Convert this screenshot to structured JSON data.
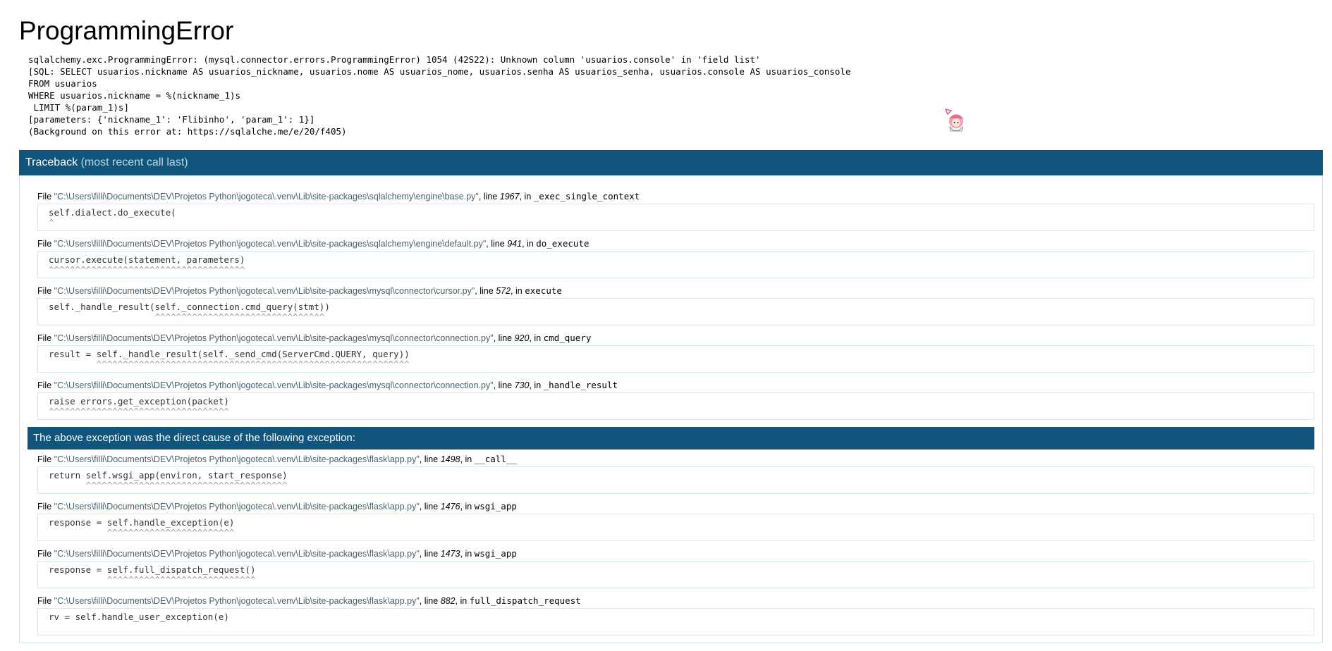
{
  "title": "ProgrammingError",
  "error_message": "sqlalchemy.exc.ProgrammingError: (mysql.connector.errors.ProgrammingError) 1054 (42S22): Unknown column 'usuarios.console' in 'field list'\n[SQL: SELECT usuarios.nickname AS usuarios_nickname, usuarios.nome AS usuarios_nome, usuarios.senha AS usuarios_senha, usuarios.console AS usuarios_console\nFROM usuarios\nWHERE usuarios.nickname = %(nickname_1)s\n LIMIT %(param_1)s]\n[parameters: {'nickname_1': 'Flibinho', 'param_1': 1}]\n(Background on this error at: https://sqlalche.me/e/20/f405)",
  "traceback": {
    "label": "Traceback",
    "note": "(most recent call last)",
    "file_word": "File",
    "line_word": "line",
    "in_word": "in",
    "frames_before": [
      {
        "file": "\"C:\\Users\\filli\\Documents\\DEV\\Projetos Python\\jogoteca\\.venv\\Lib\\site-packages\\sqlalchemy\\engine\\base.py\"",
        "line": "1967",
        "func": "_exec_single_context",
        "code": "self.dialect.do_execute(",
        "caret": "^"
      },
      {
        "file": "\"C:\\Users\\filli\\Documents\\DEV\\Projetos Python\\jogoteca\\.venv\\Lib\\site-packages\\sqlalchemy\\engine\\default.py\"",
        "line": "941",
        "func": "do_execute",
        "code": "cursor.execute(statement, parameters)",
        "caret": "^^^^^^^^^^^^^^^^^^^^^^^^^^^^^^^^^^^^^"
      },
      {
        "file": "\"C:\\Users\\filli\\Documents\\DEV\\Projetos Python\\jogoteca\\.venv\\Lib\\site-packages\\mysql\\connector\\cursor.py\"",
        "line": "572",
        "func": "execute",
        "code": "self._handle_result(self._connection.cmd_query(stmt))",
        "caret": "                    ^^^^^^^^^^^^^^^^^^^^^^^^^^^^^^^^"
      },
      {
        "file": "\"C:\\Users\\filli\\Documents\\DEV\\Projetos Python\\jogoteca\\.venv\\Lib\\site-packages\\mysql\\connector\\connection.py\"",
        "line": "920",
        "func": "cmd_query",
        "code": "result = self._handle_result(self._send_cmd(ServerCmd.QUERY, query))",
        "caret": "         ^^^^^^^^^^^^^^^^^^^^^^^^^^^^^^^^^^^^^^^^^^^^^^^^^^^^^^^^^^^"
      },
      {
        "file": "\"C:\\Users\\filli\\Documents\\DEV\\Projetos Python\\jogoteca\\.venv\\Lib\\site-packages\\mysql\\connector\\connection.py\"",
        "line": "730",
        "func": "_handle_result",
        "code": "raise errors.get_exception(packet)",
        "caret": "^^^^^^^^^^^^^^^^^^^^^^^^^^^^^^^^^^"
      }
    ],
    "cause_text": "The above exception was the direct cause of the following exception:",
    "frames_after": [
      {
        "file": "\"C:\\Users\\filli\\Documents\\DEV\\Projetos Python\\jogoteca\\.venv\\Lib\\site-packages\\flask\\app.py\"",
        "line": "1498",
        "func": "__call__",
        "code": "return self.wsgi_app(environ, start_response)",
        "caret": "       ^^^^^^^^^^^^^^^^^^^^^^^^^^^^^^^^^^^^^^"
      },
      {
        "file": "\"C:\\Users\\filli\\Documents\\DEV\\Projetos Python\\jogoteca\\.venv\\Lib\\site-packages\\flask\\app.py\"",
        "line": "1476",
        "func": "wsgi_app",
        "code": "response = self.handle_exception(e)",
        "caret": "           ^^^^^^^^^^^^^^^^^^^^^^^^"
      },
      {
        "file": "\"C:\\Users\\filli\\Documents\\DEV\\Projetos Python\\jogoteca\\.venv\\Lib\\site-packages\\flask\\app.py\"",
        "line": "1473",
        "func": "wsgi_app",
        "code": "response = self.full_dispatch_request()",
        "caret": "           ^^^^^^^^^^^^^^^^^^^^^^^^^^^^"
      },
      {
        "file": "\"C:\\Users\\filli\\Documents\\DEV\\Projetos Python\\jogoteca\\.venv\\Lib\\site-packages\\flask\\app.py\"",
        "line": "882",
        "func": "full_dispatch_request",
        "code": "rv = self.handle_user_exception(e)",
        "caret": ""
      }
    ]
  },
  "colors": {
    "header_bg": "#11557c",
    "note_color": "#b8d7e8",
    "filename_color": "#4b5f69"
  },
  "icons": {
    "mascot": "pink-haired-character-icon"
  }
}
